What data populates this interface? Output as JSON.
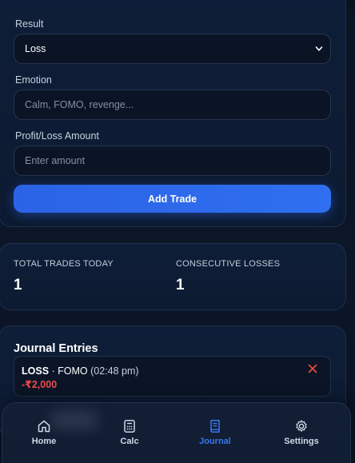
{
  "form": {
    "result_label": "Result",
    "result_value": "Loss",
    "emotion_label": "Emotion",
    "emotion_placeholder": "Calm, FOMO, revenge...",
    "amount_label": "Profit/Loss Amount",
    "amount_placeholder": "Enter amount",
    "add_button": "Add Trade"
  },
  "stats": {
    "total_label": "TOTAL TRADES TODAY",
    "total_value": "1",
    "losses_label": "CONSECUTIVE LOSSES",
    "losses_value": "1"
  },
  "journal": {
    "title": "Journal Entries",
    "entries": [
      {
        "result": "LOSS",
        "separator": " · ",
        "emotion": "FOMO",
        "time": "(02:48 pm)",
        "amount": "-₹2,000"
      }
    ]
  },
  "nav": {
    "items": [
      {
        "label": "Home",
        "icon": "home-icon"
      },
      {
        "label": "Calc",
        "icon": "calculator-icon"
      },
      {
        "label": "Journal",
        "icon": "journal-icon"
      },
      {
        "label": "Settings",
        "icon": "gear-icon"
      }
    ],
    "active": "Journal"
  },
  "colors": {
    "accent": "#2f6ff0",
    "loss": "#ef4d4d",
    "delete": "#f04a3a",
    "card": "#0f1e38"
  }
}
